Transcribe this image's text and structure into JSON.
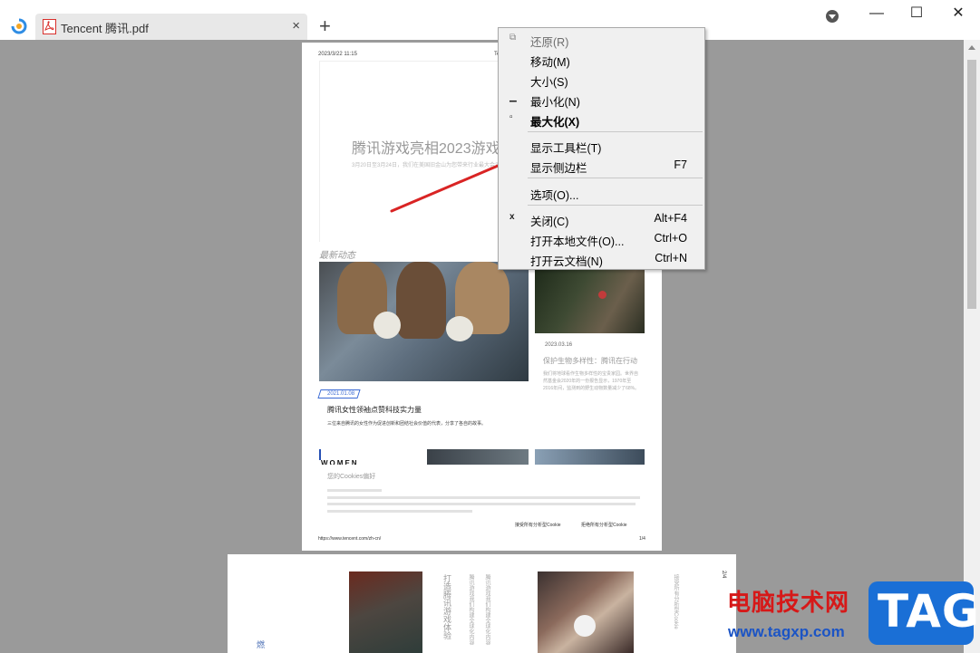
{
  "titlebar": {
    "tab_title": "Tencent 腾讯.pdf",
    "tab_close": "×",
    "new_tab": "+",
    "minimize": "—",
    "maximize": "☐",
    "close": "✕"
  },
  "page1": {
    "header_date": "2023/3/22 11:15",
    "header_right": "Te",
    "hero_title": "腾讯游戏亮相2023游戏",
    "hero_subtitle": "3月20日至3月24日，我们在美国旧金山为您带来行业最大会议",
    "section_title": "最新动态",
    "article1_date": "2021.01.08",
    "article1_title": "腾讯女性领袖点赞科技实力量",
    "article1_desc": "三位来自腾讯的女性作为促进创新和团结社会价值的代表，分享了各自的故事。",
    "article2_date": "2023.03.16",
    "article2_title": "保护生物多样性：腾讯在行动",
    "article2_body": "我们将地球看作生物多样性的宝贵家园。世界自然基金会2020年的一份报告显示，1970年至2016年间，监测到的野生动物数量减少了68%。",
    "women_label": "WOMEN",
    "cookie_title": "您的Cookies偏好",
    "cookie_accept": "接受所有分析型Cookie",
    "cookie_reject": "拒绝所有分析型Cookie",
    "footer_url": "https://www.tencent.com/zh-cn/",
    "page_number": "1/4"
  },
  "page2": {
    "vertical_title": "打造腾讯游戏体验",
    "vertical_body": "腾讯游戏我们构建全球化内容",
    "side_label": "2/4",
    "side_text": "接受所有分析型Cookie",
    "left_char": "燃"
  },
  "context_menu": {
    "items": [
      {
        "icon": "⧉",
        "label": "还原(R)",
        "shortcut": "",
        "disabled": true,
        "bold": false
      },
      {
        "icon": "",
        "label": "移动(M)",
        "shortcut": "",
        "disabled": false,
        "bold": false
      },
      {
        "icon": "",
        "label": "大小(S)",
        "shortcut": "",
        "disabled": false,
        "bold": false
      },
      {
        "icon": "▁",
        "label": "最小化(N)",
        "shortcut": "",
        "disabled": false,
        "bold": false
      },
      {
        "icon": "▫",
        "label": "最大化(X)",
        "shortcut": "",
        "disabled": false,
        "bold": true
      },
      {
        "icon": "",
        "label": "显示工具栏(T)",
        "shortcut": "",
        "disabled": false,
        "bold": false
      },
      {
        "icon": "",
        "label": "显示侧边栏",
        "shortcut": "F7",
        "disabled": false,
        "bold": false
      },
      {
        "icon": "",
        "label": "选项(O)...",
        "shortcut": "",
        "disabled": false,
        "bold": false
      },
      {
        "icon": "x",
        "label": "关闭(C)",
        "shortcut": "Alt+F4",
        "disabled": false,
        "bold": false
      },
      {
        "icon": "",
        "label": "打开本地文件(O)...",
        "shortcut": "Ctrl+O",
        "disabled": false,
        "bold": false
      },
      {
        "icon": "",
        "label": "打开云文档(N)",
        "shortcut": "Ctrl+N",
        "disabled": false,
        "bold": false
      }
    ]
  },
  "watermark": {
    "site_name": "电脑技术网",
    "site_url": "www.tagxp.com",
    "badge": "TAG"
  },
  "colors": {
    "arrow": "#d92424",
    "accent_blue": "#3a6ad4",
    "watermark_red": "#d61818",
    "watermark_blue": "#1a6fd6"
  }
}
